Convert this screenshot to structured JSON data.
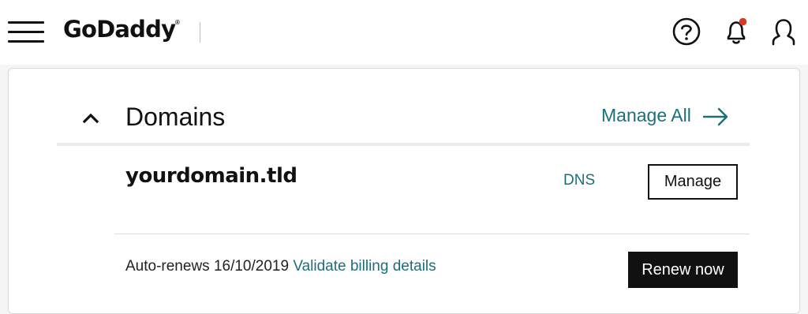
{
  "header": {
    "logo_text": "GoDaddy",
    "logo_registered": "®",
    "icons": [
      "menu-icon",
      "help-icon",
      "notification-bell-icon",
      "user-account-icon"
    ],
    "notification_dot_color": "#d93a22"
  },
  "domains_card": {
    "title": "Domains",
    "manage_all_label": "Manage All",
    "domain": {
      "name": "yourdomain.tld",
      "dns_label": "DNS",
      "manage_label": "Manage",
      "autorenew_text": "Auto-renews 16/10/2019",
      "validate_billing_label": "Validate billing details",
      "renew_now_label": "Renew now"
    }
  },
  "colors": {
    "accent_link": "#1b6f7a",
    "primary_button": "#111111",
    "text": "#111111"
  }
}
